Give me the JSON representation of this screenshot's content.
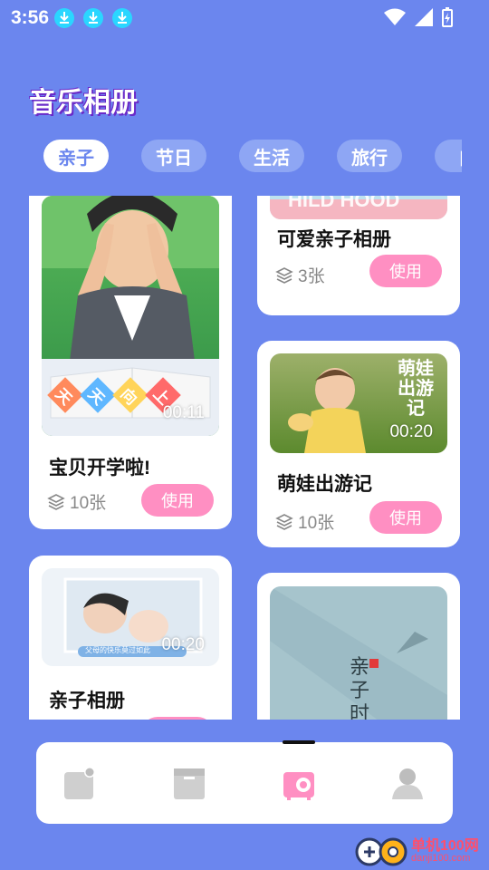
{
  "status_bar": {
    "time": "3:56"
  },
  "header": {
    "title": "音乐相册"
  },
  "tabs": [
    {
      "label": "亲子",
      "active": true
    },
    {
      "label": "节日",
      "active": false
    },
    {
      "label": "生活",
      "active": false
    },
    {
      "label": "旅行",
      "active": false
    },
    {
      "label": "自",
      "active": false
    }
  ],
  "cards": {
    "c1": {
      "title": "宝贝开学啦!",
      "count": "10张",
      "duration": "00:11",
      "use_label": "使用",
      "banner": [
        "天",
        "天",
        "向",
        "上"
      ]
    },
    "c2": {
      "title": "可爱亲子相册",
      "count": "3张",
      "use_label": "使用"
    },
    "c3": {
      "title": "萌娃出游记",
      "count": "10张",
      "duration": "00:20",
      "use_label": "使用",
      "overlay": "萌娃出游记"
    },
    "c4": {
      "title": "亲子相册",
      "duration": "00:20",
      "caption": "父母的快乐莫过如此"
    },
    "c5": {
      "overlay": "亲子时光"
    }
  },
  "bottom_nav": {
    "items": [
      "album-icon",
      "archive-icon",
      "camera-icon",
      "profile-icon"
    ],
    "active_index": 2
  },
  "watermark": {
    "main": "单机100网",
    "sub": "danji100.com"
  },
  "colors": {
    "background": "#6b86ee",
    "accent_pink": "#ff8fc2",
    "tab_inactive": "#8ea6f4"
  }
}
